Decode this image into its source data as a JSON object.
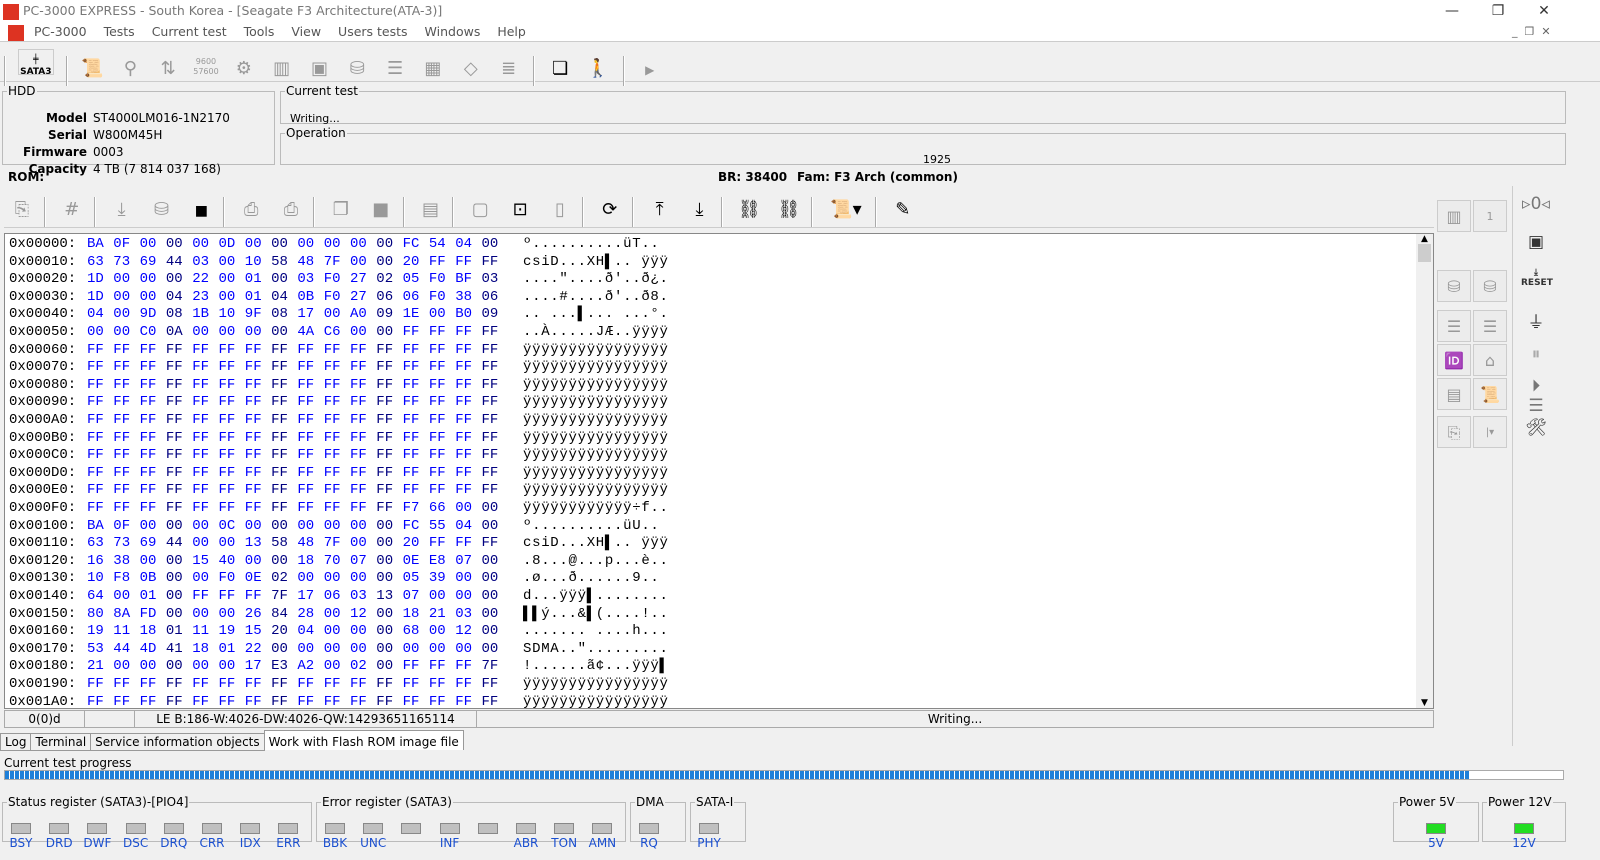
{
  "window": {
    "title": "PC-3000 EXPRESS - South Korea - [Seagate F3 Architecture(ATA-3)]",
    "logo_text": "PC"
  },
  "menu": [
    "PC-3000",
    "Tests",
    "Current test",
    "Tools",
    "View",
    "Users tests",
    "Windows",
    "Help"
  ],
  "toolbar": {
    "sata_label": "SATA3"
  },
  "hdd": {
    "legend": "HDD",
    "model_label": "Model",
    "model": "ST4000LM016-1N2170",
    "serial_label": "Serial",
    "serial": "W800M45H",
    "firmware_label": "Firmware",
    "firmware": "0003",
    "capacity_label": "Capacity",
    "capacity": "4 TB (7 814 037 168)"
  },
  "current_test": {
    "legend": "Current test",
    "value": "Writing..."
  },
  "operation": {
    "legend": "Operation",
    "value": "1925"
  },
  "rom": {
    "label": "ROM:",
    "br": "BR: 38400",
    "fam": "Fam: F3 Arch (common)"
  },
  "hex_rows": [
    {
      "addr": "0x00000:",
      "hex": "BA 0F 00 00 00 0D 00 00 00 00 00 00 FC 54 04 00",
      "ascii": "º..........üT.."
    },
    {
      "addr": "0x00010:",
      "hex": "63 73 69 44 03 00 10 58 48 7F 00 00 20 FF FF FF",
      "ascii": "csiD...XH▌.. ÿÿÿ"
    },
    {
      "addr": "0x00020:",
      "hex": "1D 00 00 00 22 00 01 00 03 F0 27 02 05 F0 BF 03",
      "ascii": "....\"....ð'..ð¿."
    },
    {
      "addr": "0x00030:",
      "hex": "1D 00 00 04 23 00 01 04 0B F0 27 06 06 F0 38 06",
      "ascii": "....#....ð'..ð8."
    },
    {
      "addr": "0x00040:",
      "hex": "04 00 9D 08 1B 10 9F 08 17 00 A0 09 1E 00 B0 09",
      "ascii": ".. ...▌... ...°."
    },
    {
      "addr": "0x00050:",
      "hex": "00 00 C0 0A 00 00 00 00 4A C6 00 00 FF FF FF FF",
      "ascii": "..À.....JÆ..ÿÿÿÿ"
    },
    {
      "addr": "0x00060:",
      "hex": "FF FF FF FF FF FF FF FF FF FF FF FF FF FF FF FF",
      "ascii": "ÿÿÿÿÿÿÿÿÿÿÿÿÿÿÿÿ"
    },
    {
      "addr": "0x00070:",
      "hex": "FF FF FF FF FF FF FF FF FF FF FF FF FF FF FF FF",
      "ascii": "ÿÿÿÿÿÿÿÿÿÿÿÿÿÿÿÿ"
    },
    {
      "addr": "0x00080:",
      "hex": "FF FF FF FF FF FF FF FF FF FF FF FF FF FF FF FF",
      "ascii": "ÿÿÿÿÿÿÿÿÿÿÿÿÿÿÿÿ"
    },
    {
      "addr": "0x00090:",
      "hex": "FF FF FF FF FF FF FF FF FF FF FF FF FF FF FF FF",
      "ascii": "ÿÿÿÿÿÿÿÿÿÿÿÿÿÿÿÿ"
    },
    {
      "addr": "0x000A0:",
      "hex": "FF FF FF FF FF FF FF FF FF FF FF FF FF FF FF FF",
      "ascii": "ÿÿÿÿÿÿÿÿÿÿÿÿÿÿÿÿ"
    },
    {
      "addr": "0x000B0:",
      "hex": "FF FF FF FF FF FF FF FF FF FF FF FF FF FF FF FF",
      "ascii": "ÿÿÿÿÿÿÿÿÿÿÿÿÿÿÿÿ"
    },
    {
      "addr": "0x000C0:",
      "hex": "FF FF FF FF FF FF FF FF FF FF FF FF FF FF FF FF",
      "ascii": "ÿÿÿÿÿÿÿÿÿÿÿÿÿÿÿÿ"
    },
    {
      "addr": "0x000D0:",
      "hex": "FF FF FF FF FF FF FF FF FF FF FF FF FF FF FF FF",
      "ascii": "ÿÿÿÿÿÿÿÿÿÿÿÿÿÿÿÿ"
    },
    {
      "addr": "0x000E0:",
      "hex": "FF FF FF FF FF FF FF FF FF FF FF FF FF FF FF FF",
      "ascii": "ÿÿÿÿÿÿÿÿÿÿÿÿÿÿÿÿ"
    },
    {
      "addr": "0x000F0:",
      "hex": "FF FF FF FF FF FF FF FF FF FF FF FF F7 66 00 00",
      "ascii": "ÿÿÿÿÿÿÿÿÿÿÿÿ÷f.."
    },
    {
      "addr": "0x00100:",
      "hex": "BA 0F 00 00 00 0C 00 00 00 00 00 00 FC 55 04 00",
      "ascii": "º..........üU.."
    },
    {
      "addr": "0x00110:",
      "hex": "63 73 69 44 00 00 13 58 48 7F 00 00 20 FF FF FF",
      "ascii": "csiD...XH▌.. ÿÿÿ"
    },
    {
      "addr": "0x00120:",
      "hex": "16 38 00 00 15 40 00 00 18 70 07 00 0E E8 07 00",
      "ascii": ".8...@...p...è.."
    },
    {
      "addr": "0x00130:",
      "hex": "10 F8 0B 00 00 F0 0E 02 00 00 00 00 05 39 00 00",
      "ascii": ".ø...ð......9.."
    },
    {
      "addr": "0x00140:",
      "hex": "64 00 01 00 FF FF FF 7F 17 06 03 13 07 00 00 00",
      "ascii": "d...ÿÿÿ▌........"
    },
    {
      "addr": "0x00150:",
      "hex": "80 8A FD 00 00 00 26 84 28 00 12 00 18 21 03 00",
      "ascii": "▌▌ý...&▌(....!.."
    },
    {
      "addr": "0x00160:",
      "hex": "19 11 18 01 11 19 15 20 04 00 00 00 68 00 12 00",
      "ascii": "....... ....h..."
    },
    {
      "addr": "0x00170:",
      "hex": "53 44 4D 41 18 01 22 00 00 00 00 00 00 00 00 00",
      "ascii": "SDMA..\"........."
    },
    {
      "addr": "0x00180:",
      "hex": "21 00 00 00 00 00 17 E3 A2 00 02 00 FF FF FF 7F",
      "ascii": "!......ã¢...ÿÿÿ▌"
    },
    {
      "addr": "0x00190:",
      "hex": "FF FF FF FF FF FF FF FF FF FF FF FF FF FF FF FF",
      "ascii": "ÿÿÿÿÿÿÿÿÿÿÿÿÿÿÿÿ"
    },
    {
      "addr": "0x001A0:",
      "hex": "FF FF FF FF FF FF FF FF FF FF FF FF FF FF FF FF",
      "ascii": "ÿÿÿÿÿÿÿÿÿÿÿÿÿÿÿÿ"
    }
  ],
  "status": {
    "pos": "0(0)d",
    "le": "LE B:186-W:4026-DW:4026-QW:14293651165114",
    "state": "Writing..."
  },
  "tabs": [
    "Log",
    "Terminal",
    "Service information objects",
    "Work with Flash ROM image file"
  ],
  "progress": {
    "label": "Current test progress",
    "percent": 94
  },
  "registers": {
    "status_legend": "Status register (SATA3)-[PIO4]",
    "status_bits": [
      "BSY",
      "DRD",
      "DWF",
      "DSC",
      "DRQ",
      "CRR",
      "IDX",
      "ERR"
    ],
    "error_legend": "Error register (SATA3)",
    "error_bits": [
      "BBK",
      "UNC",
      "",
      "INF",
      "",
      "ABR",
      "TON",
      "AMN"
    ],
    "dma_legend": "DMA",
    "dma_bits": [
      "RQ"
    ],
    "sata_legend": "SATA-I",
    "sata_bits": [
      "PHY"
    ],
    "p5_legend": "Power 5V",
    "p5": "5V",
    "p12_legend": "Power 12V",
    "p12": "12V"
  },
  "right_panel": {
    "count": "1"
  },
  "colors": {
    "hex": "#0000ff",
    "hex_dark": "#000080",
    "progress": "#1e7fd8",
    "power_on": "#22dd22"
  }
}
